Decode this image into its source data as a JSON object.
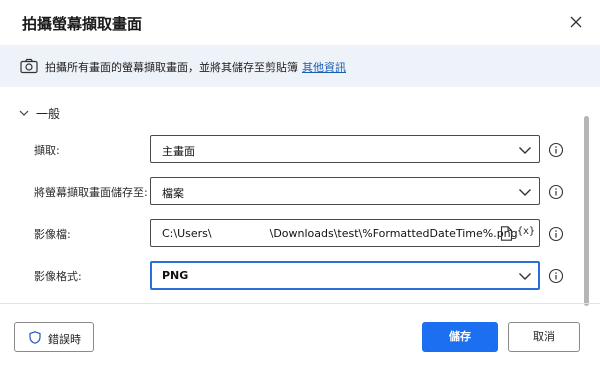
{
  "dialog": {
    "title": "拍攝螢幕擷取畫面",
    "close_icon": "close-icon"
  },
  "banner": {
    "icon": "camera-icon",
    "text": "拍攝所有畫面的螢幕擷取畫面，並將其儲存至剪貼簿",
    "link": "其他資訊"
  },
  "section": {
    "title": "一般",
    "chevron_icon": "chevron-down-icon"
  },
  "fields": {
    "capture": {
      "label": "擷取:",
      "value": "主畫面"
    },
    "save_to": {
      "label": "將螢幕擷取畫面儲存至:",
      "value": "檔案"
    },
    "image_file": {
      "label": "影像檔:",
      "value_prefix": "C:\\Users\\",
      "value_suffix": "\\Downloads\\test\\%FormattedDateTime%.png",
      "var_icon": "{x}"
    },
    "image_format": {
      "label": "影像格式:",
      "value": "PNG"
    }
  },
  "footer": {
    "on_error_label": "錯誤時",
    "save_label": "儲存",
    "cancel_label": "取消"
  },
  "colors": {
    "accent": "#1d6ff2",
    "banner_bg": "#eef2f9",
    "link": "#1a5fb4"
  }
}
